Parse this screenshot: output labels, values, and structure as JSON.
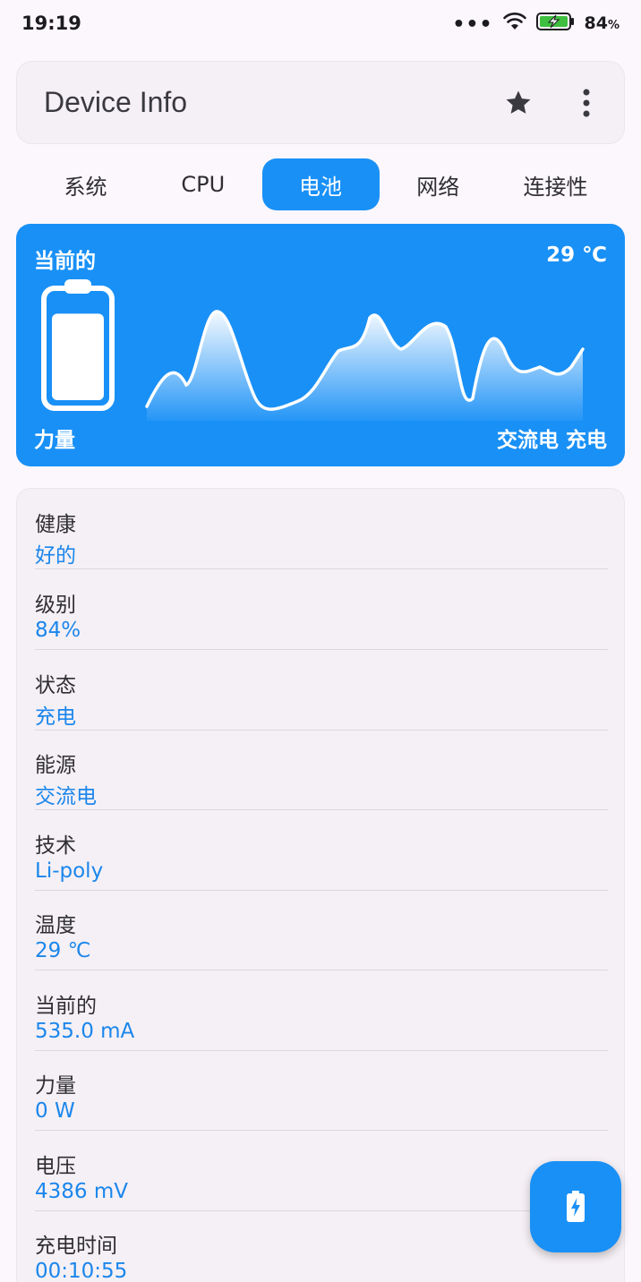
{
  "status_bar": {
    "time": "19:19",
    "dots": "•••",
    "battery_percent": "84",
    "battery_unit": "%"
  },
  "app_bar": {
    "title": "Device Info",
    "icons": [
      "star-icon",
      "more-vert-icon"
    ]
  },
  "tabs": [
    {
      "label": "系统",
      "active": false
    },
    {
      "label": "CPU",
      "active": false
    },
    {
      "label": "电池",
      "active": true
    },
    {
      "label": "网络",
      "active": false
    },
    {
      "label": "连接性",
      "active": false
    }
  ],
  "battery_card": {
    "top_left": "当前的",
    "top_right": "29 ℃",
    "bottom_left": "力量",
    "bottom_right": "交流电 充电",
    "level_fraction": 0.84,
    "color": "#1990f6"
  },
  "info": [
    {
      "label": "健康",
      "value": "好的"
    },
    {
      "label": "级别",
      "value": "84%"
    },
    {
      "label": "状态",
      "value": "充电"
    },
    {
      "label": "能源",
      "value": "交流电"
    },
    {
      "label": "技术",
      "value": "Li-poly"
    },
    {
      "label": "温度",
      "value": "29 ℃"
    },
    {
      "label": "当前的",
      "value": "535.0 mA"
    },
    {
      "label": "力量",
      "value": "0 W"
    },
    {
      "label": "电压",
      "value": "4386 mV"
    },
    {
      "label": "充电时间",
      "value": "00:10:55"
    }
  ],
  "colors": {
    "accent": "#1990f6",
    "value_text": "#1b86ec",
    "background": "#fcf7fc"
  },
  "fab": {
    "icon": "battery-charging-icon"
  }
}
